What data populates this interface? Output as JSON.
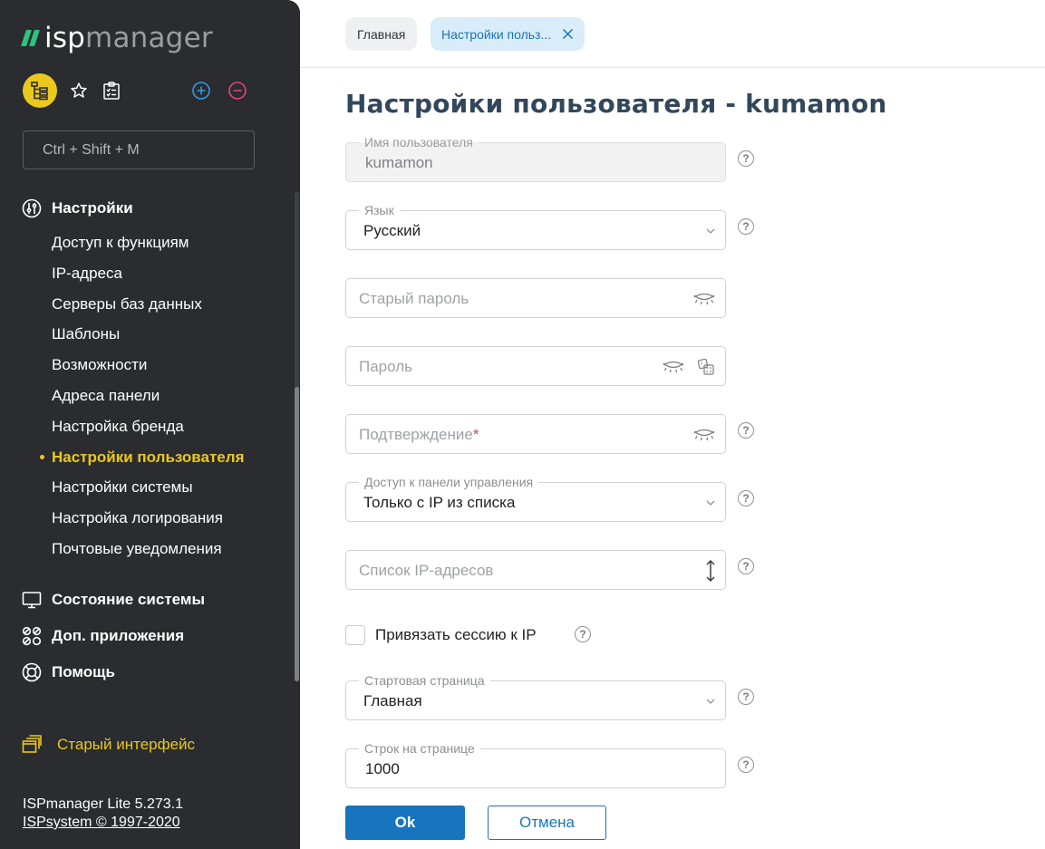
{
  "sidebar": {
    "logo": {
      "part1": "isp",
      "part2": "manager",
      "mark_color": "#2ec27e"
    },
    "quick_actions": {
      "tree_icon": "tree-icon",
      "favorites_icon": "star-icon",
      "tasks_icon": "clipboard-icon",
      "add_icon": "plus-circle-icon",
      "remove_icon": "minus-circle-icon"
    },
    "search": {
      "placeholder": "Ctrl + Shift + M"
    },
    "section_settings": "Настройки",
    "items": [
      {
        "label": "Доступ к функциям"
      },
      {
        "label": "IP-адреса"
      },
      {
        "label": "Серверы баз данных"
      },
      {
        "label": "Шаблоны"
      },
      {
        "label": "Возможности"
      },
      {
        "label": "Адреса панели"
      },
      {
        "label": "Настройка бренда"
      },
      {
        "label": "Настройки пользователя",
        "active": true
      },
      {
        "label": "Настройки системы"
      },
      {
        "label": "Настройка логирования"
      },
      {
        "label": "Почтовые уведомления"
      }
    ],
    "section_status": "Состояние системы",
    "section_apps": "Доп. приложения",
    "section_help": "Помощь",
    "old_interface": "Старый интерфейс",
    "version": "ISPmanager Lite 5.273.1",
    "copyright": "ISPsystem © 1997-2020",
    "accent_color": "#ebc81e"
  },
  "header": {
    "crumb_home": "Главная",
    "crumb_active": "Настройки польз..."
  },
  "form": {
    "title": "Настройки пользователя - kumamon",
    "username": {
      "label": "Имя пользователя",
      "value": "kumamon"
    },
    "language": {
      "label": "Язык",
      "value": "Русский"
    },
    "old_password": {
      "placeholder": "Старый пароль"
    },
    "password": {
      "placeholder": "Пароль"
    },
    "confirm": {
      "placeholder": "Подтверждение",
      "required_mark": "*"
    },
    "panel_access": {
      "label": "Доступ к панели управления",
      "value": "Только с IP из списка"
    },
    "ip_list": {
      "placeholder": "Список IP-адресов"
    },
    "bind_session": {
      "label": "Привязать сессию к IP",
      "checked": false
    },
    "start_page": {
      "label": "Стартовая страница",
      "value": "Главная"
    },
    "rows_per_page": {
      "label": "Строк на странице",
      "value": "1000"
    },
    "help_glyph": "?",
    "ok_label": "Ok",
    "cancel_label": "Отмена",
    "primary_color": "#1675be"
  }
}
